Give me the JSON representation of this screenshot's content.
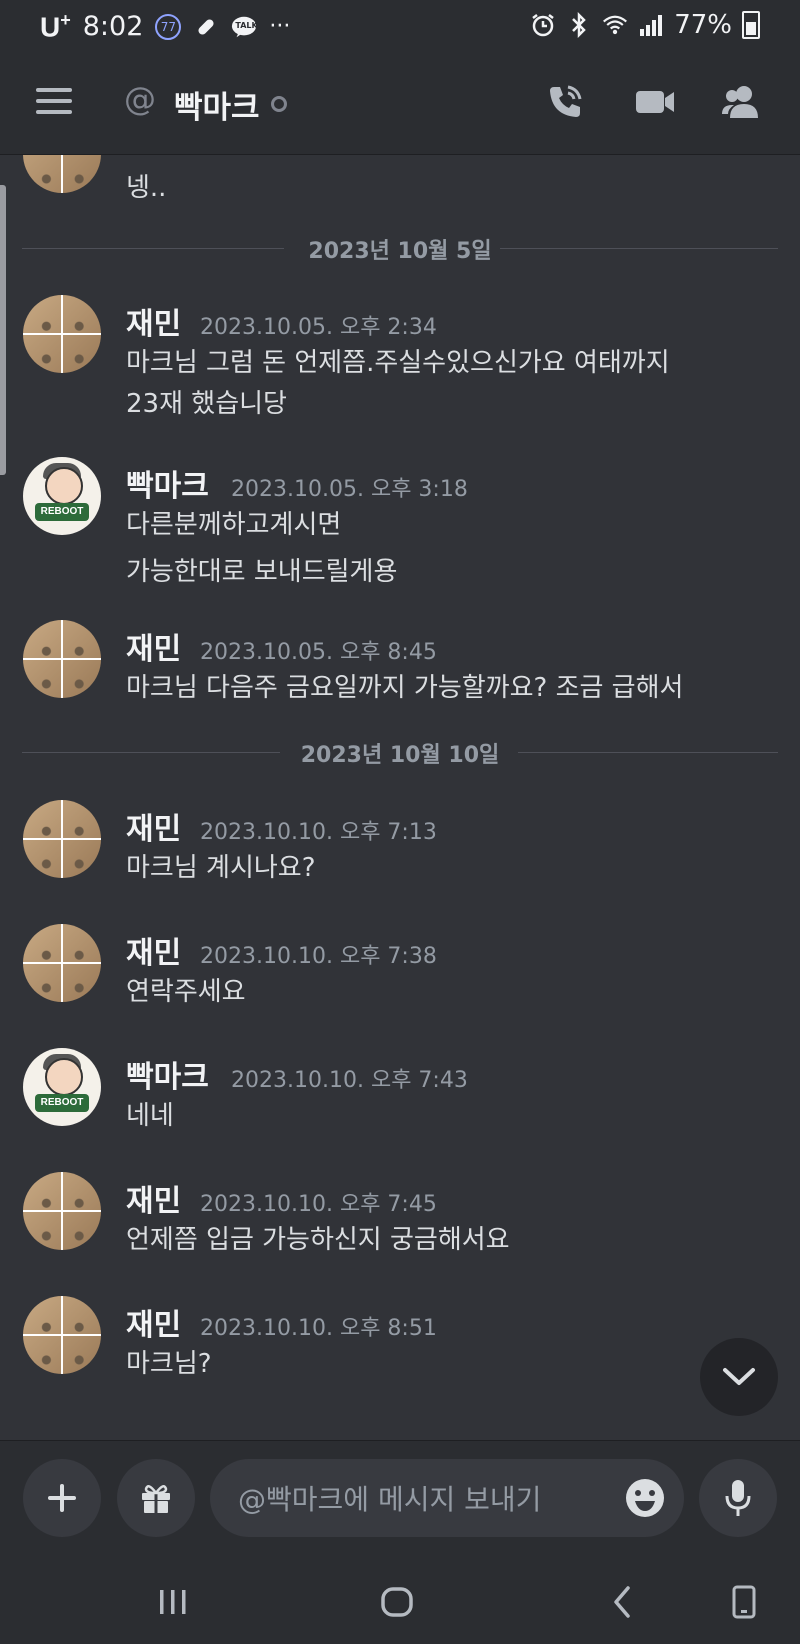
{
  "status_bar": {
    "carrier": "U",
    "carrier_sup": "+",
    "time": "8:02",
    "badge": "77",
    "talk": "TALK",
    "more": "···",
    "battery": "77%"
  },
  "header": {
    "at": "@",
    "title": "빡마크"
  },
  "chat": {
    "partial_message": {
      "text": "넹.."
    },
    "dividers": [
      "2023년 10월 5일",
      "2023년 10월 10일"
    ],
    "messages": [
      {
        "author": "재민",
        "time": "2023.10.05. 오후 2:34",
        "lines": [
          "마크님 그럼 돈 언제쯤.주실수있으신가요 여태까지",
          "23재 했습니당"
        ]
      },
      {
        "author": "빡마크",
        "time": "2023.10.05. 오후 3:18",
        "lines": [
          "다른분께하고계시면",
          "가능한대로 보내드릴게용"
        ]
      },
      {
        "author": "재민",
        "time": "2023.10.05. 오후 8:45",
        "lines": [
          "마크님 다음주 금요일까지 가능할까요? 조금 급해서"
        ]
      },
      {
        "author": "재민",
        "time": "2023.10.10. 오후 7:13",
        "lines": [
          "마크님 계시나요?"
        ]
      },
      {
        "author": "재민",
        "time": "2023.10.10. 오후 7:38",
        "lines": [
          "연락주세요"
        ]
      },
      {
        "author": "빡마크",
        "time": "2023.10.10. 오후 7:43",
        "lines": [
          "네네"
        ]
      },
      {
        "author": "재민",
        "time": "2023.10.10. 오후 7:45",
        "lines": [
          "언제쯤 입금 가능하신지 궁금해서요"
        ]
      },
      {
        "author": "재민",
        "time": "2023.10.10. 오후 8:51",
        "lines": [
          "마크님?"
        ]
      }
    ],
    "avatar_badge": "REBOOT"
  },
  "composer": {
    "placeholder": "@빡마크에 메시지 보내기"
  },
  "colors": {
    "background": "#313338",
    "header": "#2b2d31",
    "text": "#dbdee1",
    "muted": "#949ba4"
  }
}
